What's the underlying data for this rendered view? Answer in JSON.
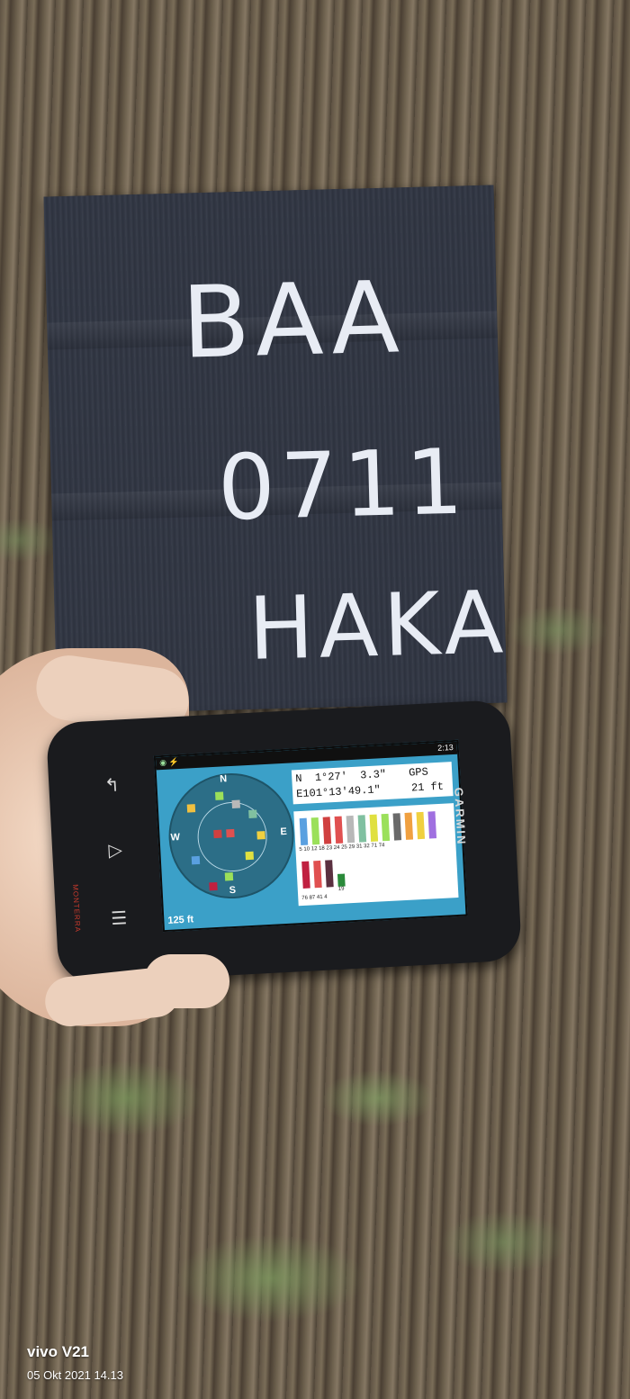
{
  "photo": {
    "tag_lines": [
      "BAA",
      "0711",
      "HAKA"
    ]
  },
  "gps": {
    "brand": "GARMIN",
    "model": "MONTERRA",
    "time": "2:13",
    "lat": "N  1°27'  3.3\"",
    "fix": "GPS",
    "lon": "E101°13'49.1\"",
    "accuracy": "21 ft",
    "scale": "125 ft",
    "compass": [
      "N",
      "E",
      "S",
      "W"
    ],
    "sat_ids_top": "5 10 12 18 23 24 25 29 31 32 71 74",
    "sat_ids_bottom": "76 87 41 4",
    "sat_label_19": "19"
  },
  "watermark": {
    "device": "vivo V21",
    "datetime": "05 Okt 2021 14.13"
  }
}
